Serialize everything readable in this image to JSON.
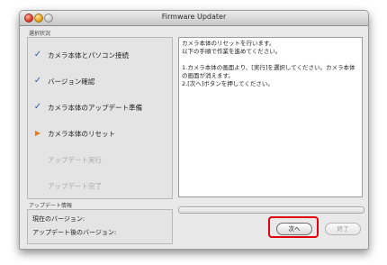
{
  "window": {
    "title": "Firmware Updater"
  },
  "steps": {
    "section_label": "選択状況",
    "items": [
      {
        "label": "カメラ本体とパソコン接続",
        "state": "done",
        "icon": "check-icon"
      },
      {
        "label": "バージョン確認",
        "state": "done",
        "icon": "check-icon"
      },
      {
        "label": "カメラ本体のアップデート準備",
        "state": "done",
        "icon": "check-icon"
      },
      {
        "label": "カメラ本体のリセット",
        "state": "current",
        "icon": "arrow-right-icon"
      },
      {
        "label": "アップデート実行",
        "state": "pending",
        "icon": ""
      },
      {
        "label": "アップデート完了",
        "state": "pending",
        "icon": ""
      }
    ]
  },
  "message": {
    "lines": [
      "カメラ本体のリセットを行います。",
      "以下の手順で作業を進めてください。",
      "",
      "1.カメラ本体の画面より、[実行]を選択してください。カメラ本体の画面が消えます。",
      "2.[次へ]ボタンを押してください。"
    ]
  },
  "info": {
    "section_label": "アップデート情報",
    "current_version_label": "現在のバージョン:",
    "updated_version_label": "アップデート後のバージョン:"
  },
  "buttons": {
    "next": "次へ",
    "quit": "終了"
  },
  "colors": {
    "check": "#2b5ea9",
    "arrow": "#e07a1f",
    "highlight": "#e3000f"
  }
}
